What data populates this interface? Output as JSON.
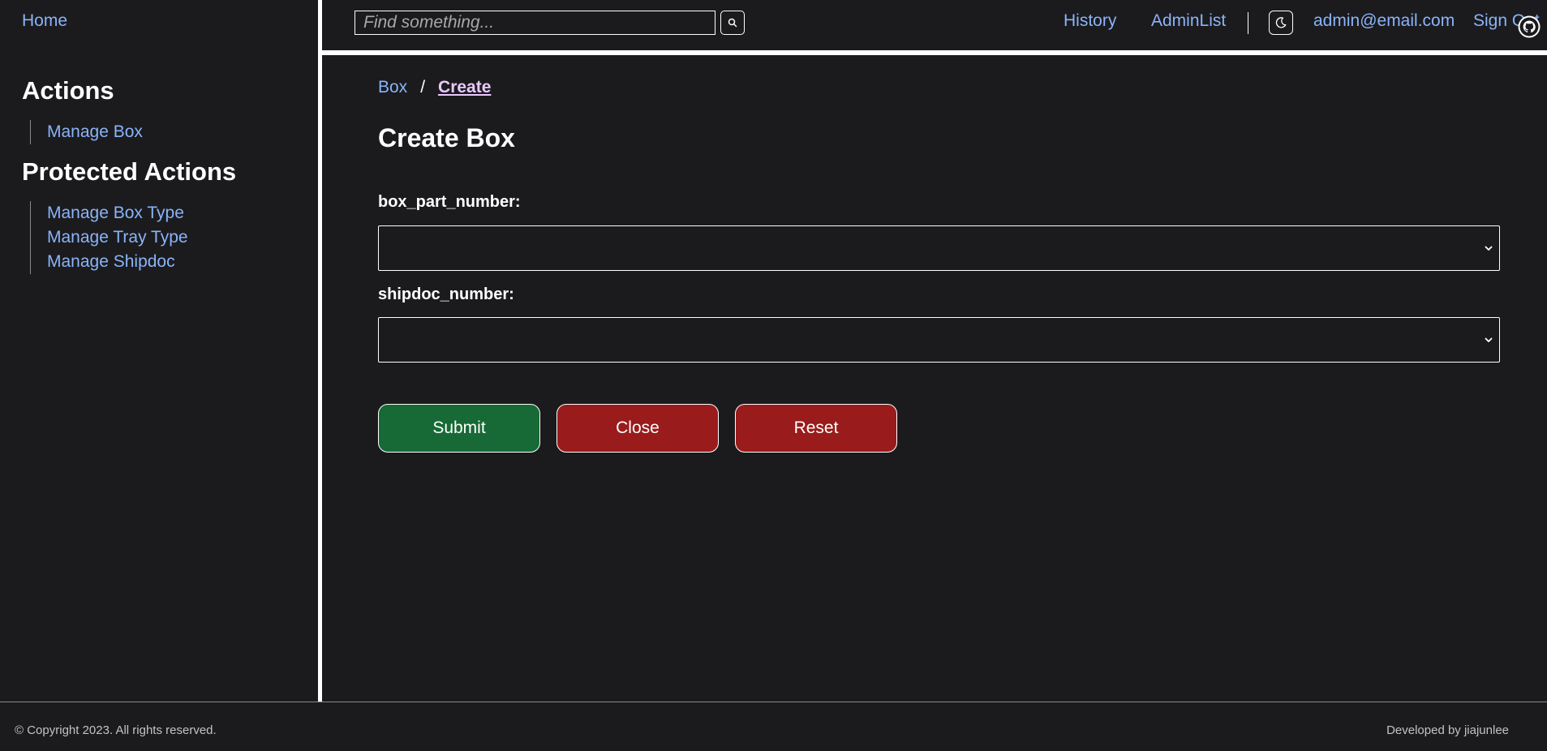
{
  "sidebar": {
    "home": "Home",
    "actions_title": "Actions",
    "actions": [
      {
        "label": "Manage Box"
      }
    ],
    "protected_title": "Protected Actions",
    "protected": [
      {
        "label": "Manage Box Type"
      },
      {
        "label": "Manage Tray Type"
      },
      {
        "label": "Manage Shipdoc"
      }
    ]
  },
  "topbar": {
    "search_placeholder": "Find something...",
    "search_icon": "search-icon",
    "history": "History",
    "admin_list": "AdminList",
    "theme_icon": "moon-icon",
    "user_email": "admin@email.com",
    "sign_out": "Sign Out"
  },
  "breadcrumb": {
    "parent": "Box",
    "separator": "/",
    "current": "Create"
  },
  "main": {
    "title": "Create Box",
    "fields": [
      {
        "label": "box_part_number:",
        "value": ""
      },
      {
        "label": "shipdoc_number:",
        "value": ""
      }
    ],
    "buttons": {
      "submit": "Submit",
      "close": "Close",
      "reset": "Reset"
    }
  },
  "footer": {
    "copyright": "© Copyright 2023. All rights reserved.",
    "developer": "Developed by jiajunlee",
    "github_icon": "github-icon"
  },
  "colors": {
    "background": "#1b1b1e",
    "link": "#8ab4f8",
    "breadcrumb_current": "#e9c8ff",
    "submit": "#176a35",
    "danger": "#9a1b1b"
  }
}
